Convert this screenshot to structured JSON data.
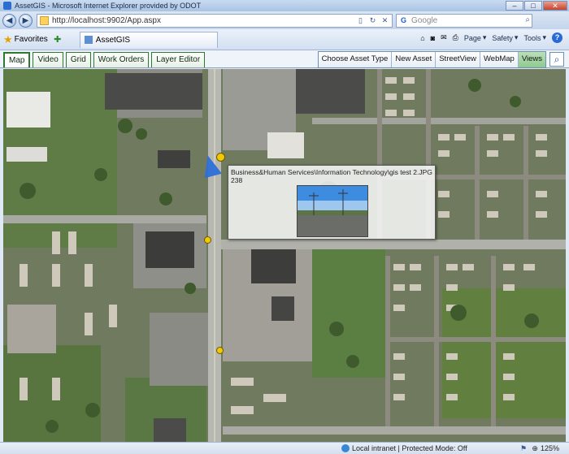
{
  "window": {
    "title": "AssetGIS - Microsoft Internet Explorer provided by ODOT",
    "minimize": "–",
    "maximize": "□",
    "close": "✕"
  },
  "address_bar": {
    "url": "http://localhost:9902/App.aspx",
    "back_icon": "back-arrow-icon",
    "forward_icon": "forward-arrow-icon"
  },
  "search_box": {
    "engine": "Google",
    "placeholder": "Google"
  },
  "favorites": {
    "label": "Favorites"
  },
  "browser_tab": {
    "label": "AssetGIS"
  },
  "command_bar": {
    "page": "Page",
    "safety": "Safety",
    "tools": "Tools"
  },
  "app_tabs": [
    {
      "label": "Map"
    },
    {
      "label": "Video"
    },
    {
      "label": "Grid"
    },
    {
      "label": "Work Orders"
    },
    {
      "label": "Layer Editor"
    }
  ],
  "toolbar_buttons": [
    {
      "label": "Choose Asset Type"
    },
    {
      "label": "New Asset"
    },
    {
      "label": "StreetView"
    },
    {
      "label": "WebMap"
    },
    {
      "label": "Views"
    }
  ],
  "popup": {
    "path": "Business&Human Services\\Information Technology\\gis test 2.JPG",
    "id": "238"
  },
  "status_bar": {
    "zone": "Local intranet | Protected Mode: Off",
    "zoom": "125%"
  }
}
